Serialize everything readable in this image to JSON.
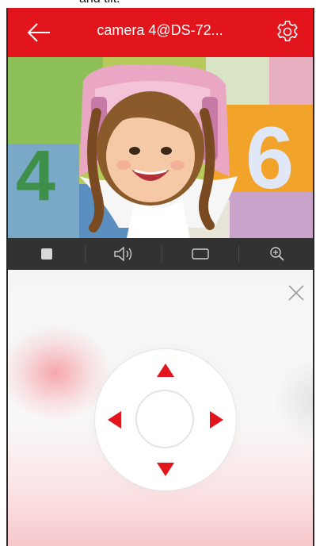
{
  "caption": "and tilt.",
  "header": {
    "title": "camera 4@DS-72...",
    "back_icon": "arrow-left-icon",
    "settings_icon": "gear-icon",
    "background_color": "#e2141c"
  },
  "video": {
    "description_icon": "live-video-feed",
    "puzzle_tile_digits": [
      "4",
      "6"
    ]
  },
  "controls": [
    {
      "icon": "stop-icon"
    },
    {
      "icon": "speaker-icon"
    },
    {
      "icon": "screen-ratio-icon"
    },
    {
      "icon": "zoom-in-icon"
    }
  ],
  "ptz": {
    "close_icon": "close-icon",
    "directions": [
      "up",
      "down",
      "left",
      "right"
    ],
    "arrow_color": "#e2141c"
  }
}
